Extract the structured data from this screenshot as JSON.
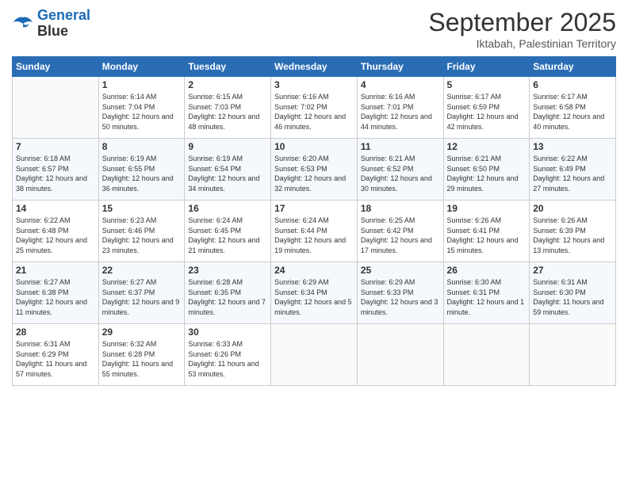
{
  "logo": {
    "line1": "General",
    "line2": "Blue"
  },
  "title": "September 2025",
  "subtitle": "Iktabah, Palestinian Territory",
  "days_of_week": [
    "Sunday",
    "Monday",
    "Tuesday",
    "Wednesday",
    "Thursday",
    "Friday",
    "Saturday"
  ],
  "weeks": [
    [
      {
        "day": "",
        "sunrise": "",
        "sunset": "",
        "daylight": ""
      },
      {
        "day": "1",
        "sunrise": "Sunrise: 6:14 AM",
        "sunset": "Sunset: 7:04 PM",
        "daylight": "Daylight: 12 hours and 50 minutes."
      },
      {
        "day": "2",
        "sunrise": "Sunrise: 6:15 AM",
        "sunset": "Sunset: 7:03 PM",
        "daylight": "Daylight: 12 hours and 48 minutes."
      },
      {
        "day": "3",
        "sunrise": "Sunrise: 6:16 AM",
        "sunset": "Sunset: 7:02 PM",
        "daylight": "Daylight: 12 hours and 46 minutes."
      },
      {
        "day": "4",
        "sunrise": "Sunrise: 6:16 AM",
        "sunset": "Sunset: 7:01 PM",
        "daylight": "Daylight: 12 hours and 44 minutes."
      },
      {
        "day": "5",
        "sunrise": "Sunrise: 6:17 AM",
        "sunset": "Sunset: 6:59 PM",
        "daylight": "Daylight: 12 hours and 42 minutes."
      },
      {
        "day": "6",
        "sunrise": "Sunrise: 6:17 AM",
        "sunset": "Sunset: 6:58 PM",
        "daylight": "Daylight: 12 hours and 40 minutes."
      }
    ],
    [
      {
        "day": "7",
        "sunrise": "Sunrise: 6:18 AM",
        "sunset": "Sunset: 6:57 PM",
        "daylight": "Daylight: 12 hours and 38 minutes."
      },
      {
        "day": "8",
        "sunrise": "Sunrise: 6:19 AM",
        "sunset": "Sunset: 6:55 PM",
        "daylight": "Daylight: 12 hours and 36 minutes."
      },
      {
        "day": "9",
        "sunrise": "Sunrise: 6:19 AM",
        "sunset": "Sunset: 6:54 PM",
        "daylight": "Daylight: 12 hours and 34 minutes."
      },
      {
        "day": "10",
        "sunrise": "Sunrise: 6:20 AM",
        "sunset": "Sunset: 6:53 PM",
        "daylight": "Daylight: 12 hours and 32 minutes."
      },
      {
        "day": "11",
        "sunrise": "Sunrise: 6:21 AM",
        "sunset": "Sunset: 6:52 PM",
        "daylight": "Daylight: 12 hours and 30 minutes."
      },
      {
        "day": "12",
        "sunrise": "Sunrise: 6:21 AM",
        "sunset": "Sunset: 6:50 PM",
        "daylight": "Daylight: 12 hours and 29 minutes."
      },
      {
        "day": "13",
        "sunrise": "Sunrise: 6:22 AM",
        "sunset": "Sunset: 6:49 PM",
        "daylight": "Daylight: 12 hours and 27 minutes."
      }
    ],
    [
      {
        "day": "14",
        "sunrise": "Sunrise: 6:22 AM",
        "sunset": "Sunset: 6:48 PM",
        "daylight": "Daylight: 12 hours and 25 minutes."
      },
      {
        "day": "15",
        "sunrise": "Sunrise: 6:23 AM",
        "sunset": "Sunset: 6:46 PM",
        "daylight": "Daylight: 12 hours and 23 minutes."
      },
      {
        "day": "16",
        "sunrise": "Sunrise: 6:24 AM",
        "sunset": "Sunset: 6:45 PM",
        "daylight": "Daylight: 12 hours and 21 minutes."
      },
      {
        "day": "17",
        "sunrise": "Sunrise: 6:24 AM",
        "sunset": "Sunset: 6:44 PM",
        "daylight": "Daylight: 12 hours and 19 minutes."
      },
      {
        "day": "18",
        "sunrise": "Sunrise: 6:25 AM",
        "sunset": "Sunset: 6:42 PM",
        "daylight": "Daylight: 12 hours and 17 minutes."
      },
      {
        "day": "19",
        "sunrise": "Sunrise: 6:26 AM",
        "sunset": "Sunset: 6:41 PM",
        "daylight": "Daylight: 12 hours and 15 minutes."
      },
      {
        "day": "20",
        "sunrise": "Sunrise: 6:26 AM",
        "sunset": "Sunset: 6:39 PM",
        "daylight": "Daylight: 12 hours and 13 minutes."
      }
    ],
    [
      {
        "day": "21",
        "sunrise": "Sunrise: 6:27 AM",
        "sunset": "Sunset: 6:38 PM",
        "daylight": "Daylight: 12 hours and 11 minutes."
      },
      {
        "day": "22",
        "sunrise": "Sunrise: 6:27 AM",
        "sunset": "Sunset: 6:37 PM",
        "daylight": "Daylight: 12 hours and 9 minutes."
      },
      {
        "day": "23",
        "sunrise": "Sunrise: 6:28 AM",
        "sunset": "Sunset: 6:35 PM",
        "daylight": "Daylight: 12 hours and 7 minutes."
      },
      {
        "day": "24",
        "sunrise": "Sunrise: 6:29 AM",
        "sunset": "Sunset: 6:34 PM",
        "daylight": "Daylight: 12 hours and 5 minutes."
      },
      {
        "day": "25",
        "sunrise": "Sunrise: 6:29 AM",
        "sunset": "Sunset: 6:33 PM",
        "daylight": "Daylight: 12 hours and 3 minutes."
      },
      {
        "day": "26",
        "sunrise": "Sunrise: 6:30 AM",
        "sunset": "Sunset: 6:31 PM",
        "daylight": "Daylight: 12 hours and 1 minute."
      },
      {
        "day": "27",
        "sunrise": "Sunrise: 6:31 AM",
        "sunset": "Sunset: 6:30 PM",
        "daylight": "Daylight: 11 hours and 59 minutes."
      }
    ],
    [
      {
        "day": "28",
        "sunrise": "Sunrise: 6:31 AM",
        "sunset": "Sunset: 6:29 PM",
        "daylight": "Daylight: 11 hours and 57 minutes."
      },
      {
        "day": "29",
        "sunrise": "Sunrise: 6:32 AM",
        "sunset": "Sunset: 6:28 PM",
        "daylight": "Daylight: 11 hours and 55 minutes."
      },
      {
        "day": "30",
        "sunrise": "Sunrise: 6:33 AM",
        "sunset": "Sunset: 6:26 PM",
        "daylight": "Daylight: 11 hours and 53 minutes."
      },
      {
        "day": "",
        "sunrise": "",
        "sunset": "",
        "daylight": ""
      },
      {
        "day": "",
        "sunrise": "",
        "sunset": "",
        "daylight": ""
      },
      {
        "day": "",
        "sunrise": "",
        "sunset": "",
        "daylight": ""
      },
      {
        "day": "",
        "sunrise": "",
        "sunset": "",
        "daylight": ""
      }
    ]
  ]
}
